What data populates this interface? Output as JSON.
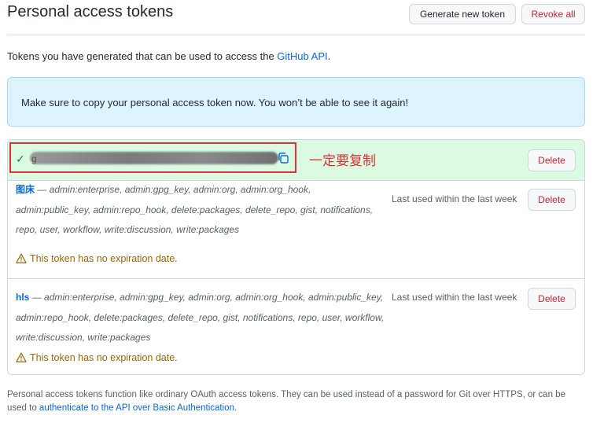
{
  "header": {
    "title": "Personal access tokens",
    "generate_label": "Generate new token",
    "revoke_label": "Revoke all"
  },
  "intro": {
    "text": "Tokens you have generated that can be used to access the ",
    "link": "GitHub API",
    "after": "."
  },
  "flash": {
    "message": "Make sure to copy your personal access token now. You won’t be able to see it again!"
  },
  "new_token": {
    "visible_prefix": "g",
    "annotation": "一定要复制",
    "delete_label": "Delete"
  },
  "tokens": [
    {
      "name": "图床",
      "dash": " — ",
      "scopes": "admin:enterprise, admin:gpg_key, admin:org, admin:org_hook, admin:public_key, admin:repo_hook, delete:packages, delete_repo, gist, notifications, repo, user, workflow, write:discussion, write:packages",
      "last_used": "Last used within the last week",
      "warning": "This token has no expiration date.",
      "delete_label": "Delete"
    },
    {
      "name": "hls",
      "dash": " — ",
      "scopes": "admin:enterprise, admin:gpg_key, admin:org, admin:org_hook, admin:public_key, admin:repo_hook, delete:packages, delete_repo, gist, notifications, repo, user, workflow, write:discussion, write:packages",
      "last_used": "Last used within the last week",
      "warning": "This token has no expiration date.",
      "delete_label": "Delete"
    }
  ],
  "footer": {
    "text": "Personal access tokens function like ordinary OAuth access tokens. They can be used instead of a password for Git over HTTPS, or can be used to ",
    "link": "authenticate to the API over Basic Authentication",
    "after": "."
  },
  "colors": {
    "danger": "#cf222e",
    "link": "#0969da",
    "annotation": "#e0313a",
    "success_bg": "#dafbe1",
    "flash_bg": "#ddf4ff"
  },
  "icons": {
    "check": "check-icon",
    "copy": "copy-icon",
    "warning": "alert-icon"
  }
}
